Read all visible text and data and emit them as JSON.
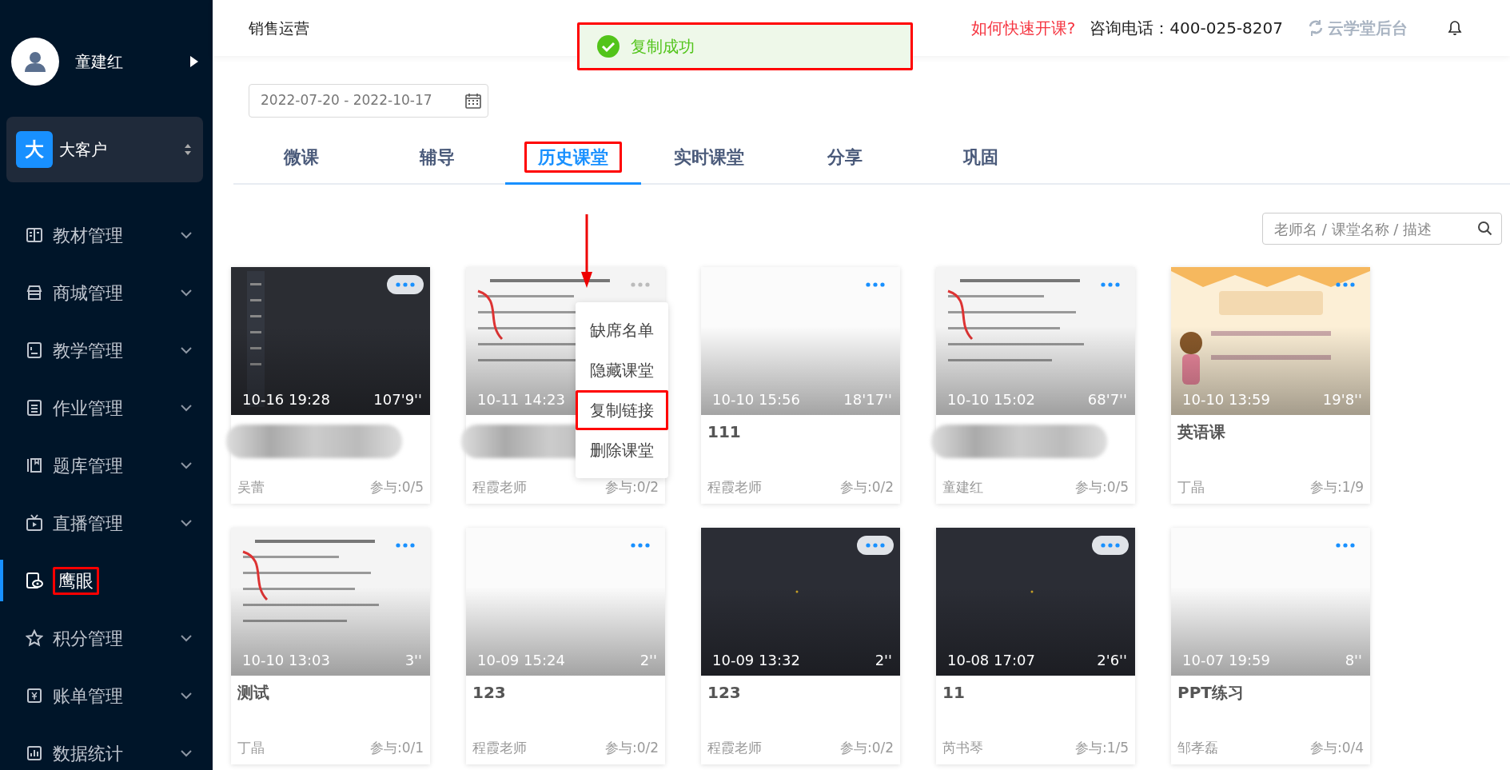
{
  "user": {
    "name": "童建红"
  },
  "org": {
    "badge": "大",
    "name": "大客户"
  },
  "sidebar": {
    "items": [
      {
        "label": "教材管理",
        "selected": false,
        "expandable": true,
        "highlighted": false
      },
      {
        "label": "商城管理",
        "selected": false,
        "expandable": true,
        "highlighted": false
      },
      {
        "label": "教学管理",
        "selected": false,
        "expandable": true,
        "highlighted": false
      },
      {
        "label": "作业管理",
        "selected": false,
        "expandable": true,
        "highlighted": false
      },
      {
        "label": "题库管理",
        "selected": false,
        "expandable": true,
        "highlighted": false
      },
      {
        "label": "直播管理",
        "selected": false,
        "expandable": true,
        "highlighted": false
      },
      {
        "label": "鹰眼",
        "selected": true,
        "expandable": false,
        "highlighted": true
      },
      {
        "label": "积分管理",
        "selected": false,
        "expandable": true,
        "highlighted": false
      },
      {
        "label": "账单管理",
        "selected": false,
        "expandable": true,
        "highlighted": false
      },
      {
        "label": "数据统计",
        "selected": false,
        "expandable": true,
        "highlighted": false
      }
    ]
  },
  "header": {
    "title": "销售运营",
    "help_link": "如何快速开课?",
    "phone": "咨询电话：400-025-8207",
    "backend_link": "云学堂后台"
  },
  "toast": {
    "message": "复制成功",
    "highlighted": true
  },
  "date_range": {
    "value": "2022-07-20 - 2022-10-17"
  },
  "tabs": [
    {
      "label": "微课",
      "selected": false,
      "highlighted": false
    },
    {
      "label": "辅导",
      "selected": false,
      "highlighted": false
    },
    {
      "label": "历史课堂",
      "selected": true,
      "highlighted": true
    },
    {
      "label": "实时课堂",
      "selected": false,
      "highlighted": false
    },
    {
      "label": "分享",
      "selected": false,
      "highlighted": false
    },
    {
      "label": "巩固",
      "selected": false,
      "highlighted": false
    }
  ],
  "search": {
    "placeholder": "老师名 / 课堂名称 / 描述"
  },
  "cards": [
    {
      "time": "10-16 19:28",
      "duration": "107'9''",
      "redacted": true,
      "teacher": "吴蕾",
      "participation": "参与:0/5",
      "dark": true,
      "menu_open": false
    },
    {
      "time": "10-11 14:23",
      "redacted": true,
      "teacher": "程霞老师",
      "participation": "参与:0/2",
      "dark": false,
      "menu_open": true,
      "menu": [
        {
          "label": "缺席名单",
          "highlighted": false
        },
        {
          "label": "隐藏课堂",
          "highlighted": false
        },
        {
          "label": "复制链接",
          "highlighted": true
        },
        {
          "label": "删除课堂",
          "highlighted": false
        }
      ]
    },
    {
      "time": "10-10 15:56",
      "duration": "18'17''",
      "title": "111",
      "teacher": "程霞老师",
      "participation": "参与:0/2",
      "dark": false,
      "menu_open": false
    },
    {
      "time": "10-10 15:02",
      "duration": "68'7''",
      "redacted": true,
      "teacher": "童建红",
      "participation": "参与:0/5",
      "dark": false,
      "menu_open": false
    },
    {
      "time": "10-10 13:59",
      "duration": "19'8''",
      "title": "英语课",
      "teacher": "丁晶",
      "participation": "参与:1/9",
      "dark": false,
      "menu_open": false
    },
    {
      "time": "10-10 13:03",
      "duration": "3''",
      "title": "测试",
      "teacher": "丁晶",
      "participation": "参与:0/1",
      "dark": false,
      "menu_open": false
    },
    {
      "time": "10-09 15:24",
      "duration": "2''",
      "title": "123",
      "teacher": "程霞老师",
      "participation": "参与:0/2",
      "dark": false,
      "menu_open": false
    },
    {
      "time": "10-09 13:32",
      "duration": "2''",
      "title": "123",
      "teacher": "程霞老师",
      "participation": "参与:0/2",
      "dark": true,
      "menu_open": false
    },
    {
      "time": "10-08 17:07",
      "duration": "2'6''",
      "title": "11",
      "teacher": "芮书琴",
      "participation": "参与:1/5",
      "dark": true,
      "menu_open": false
    },
    {
      "time": "10-07 19:59",
      "duration": "8''",
      "title": "PPT练习",
      "teacher": "邹孝磊",
      "participation": "参与:0/4",
      "dark": false,
      "menu_open": false
    }
  ]
}
